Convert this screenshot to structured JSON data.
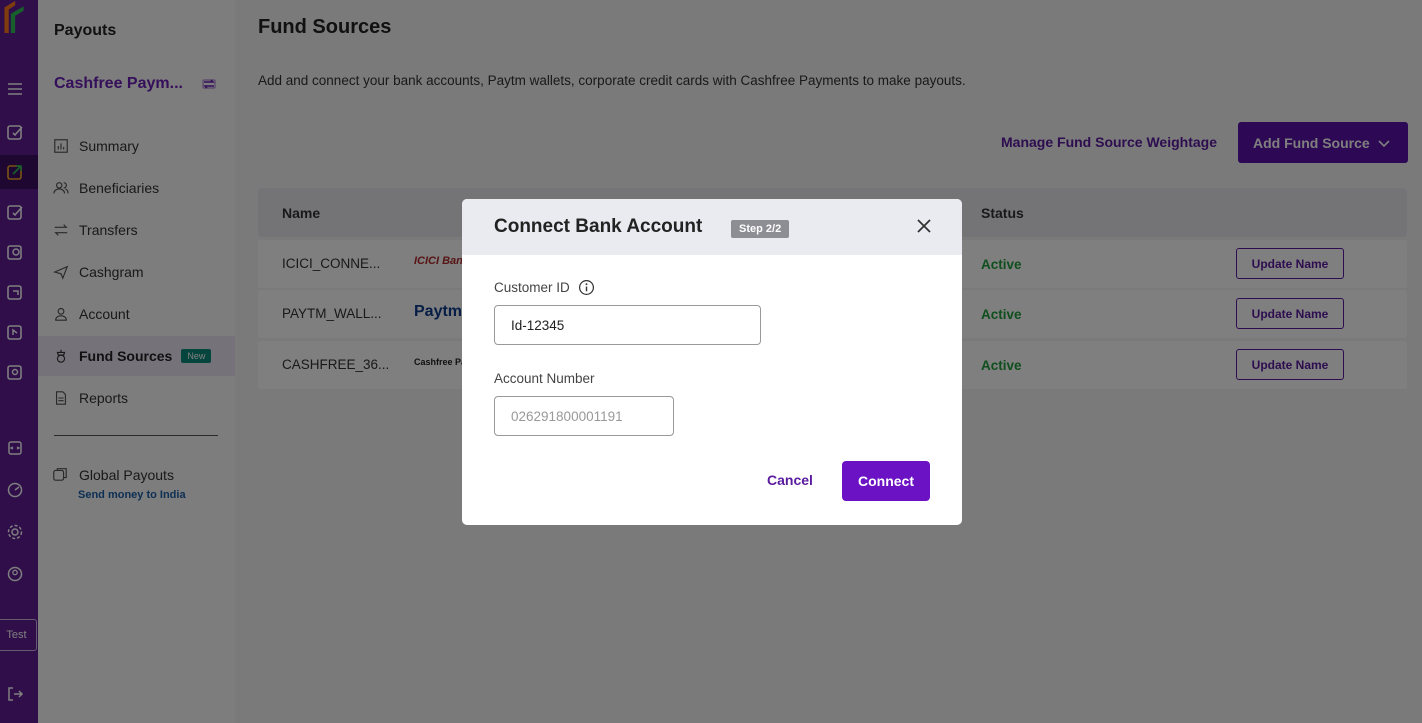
{
  "rail": {
    "test_label": "Test"
  },
  "sidebar": {
    "title": "Payouts",
    "account_name": "Cashfree Paym...",
    "items": [
      {
        "label": "Summary",
        "icon": "chart-icon"
      },
      {
        "label": "Beneficiaries",
        "icon": "users-icon"
      },
      {
        "label": "Transfers",
        "icon": "transfer-icon"
      },
      {
        "label": "Cashgram",
        "icon": "send-icon"
      },
      {
        "label": "Account",
        "icon": "user-icon"
      },
      {
        "label": "Fund Sources",
        "icon": "fund-icon",
        "badge": "New",
        "active": true
      },
      {
        "label": "Reports",
        "icon": "document-icon"
      }
    ],
    "global": {
      "label": "Global Payouts",
      "sub": "Send money to India"
    }
  },
  "main": {
    "title": "Fund Sources",
    "description": "Add and connect your bank accounts, Paytm wallets, corporate credit cards with Cashfree Payments to make payouts.",
    "manage_link": "Manage Fund Source Weightage",
    "add_button": "Add Fund Source",
    "table": {
      "headers": {
        "name": "Name",
        "status": "Status"
      },
      "rows": [
        {
          "name": "ICICI_CONNE...",
          "logo": "ICICI Bank",
          "status": "Active",
          "action": "Update Name"
        },
        {
          "name": "PAYTM_WALL...",
          "logo": "Paytm",
          "status": "Active",
          "action": "Update Name"
        },
        {
          "name": "CASHFREE_36...",
          "logo": "Cashfree Payments",
          "status": "Active",
          "action": "Update Name"
        }
      ]
    }
  },
  "modal": {
    "title": "Connect Bank Account",
    "step": "Step 2/2",
    "customer_id_label": "Customer ID",
    "customer_id_value": "Id-12345",
    "account_number_label": "Account Number",
    "account_number_placeholder": "026291800001191",
    "cancel": "Cancel",
    "connect": "Connect"
  },
  "colors": {
    "rail": "#5f1d95",
    "accent": "#6a12c4",
    "status_active": "#1f9d3a"
  }
}
